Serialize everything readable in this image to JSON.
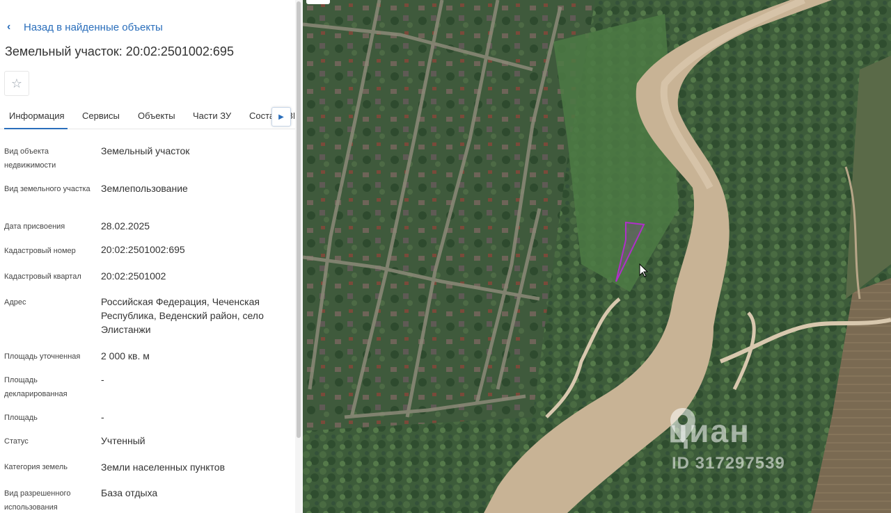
{
  "nav": {
    "back_label": "Назад в найденные объекты"
  },
  "object": {
    "title": "Земельный участок: 20:02:2501002:695"
  },
  "tabs": [
    {
      "label": "Информация"
    },
    {
      "label": "Сервисы"
    },
    {
      "label": "Объекты"
    },
    {
      "label": "Части ЗУ"
    },
    {
      "label": "Состав ЕЗП"
    }
  ],
  "info": [
    {
      "label": "Вид объекта недвижимости",
      "value": "Земельный участок"
    },
    {
      "label": "Вид земельного участка",
      "value": "Землепользование"
    },
    {
      "label": "Дата присвоения",
      "value": "28.02.2025"
    },
    {
      "label": "Кадастровый номер",
      "value": "20:02:2501002:695"
    },
    {
      "label": "Кадастровый квартал",
      "value": "20:02:2501002"
    },
    {
      "label": "Адрес",
      "value": "Российская Федерация, Чеченская Республика, Веденский район, село Элистанжи"
    },
    {
      "label": "Площадь уточненная",
      "value": "2 000 кв. м"
    },
    {
      "label": "Площадь декларированная",
      "value": "-"
    },
    {
      "label": "Площадь",
      "value": "-"
    },
    {
      "label": "Статус",
      "value": "Учтенный"
    },
    {
      "label": "Категория земель",
      "value": "Земли населенных пунктов"
    },
    {
      "label": "Вид разрешенного использования",
      "value": "База отдыха"
    }
  ],
  "watermark": {
    "brand": "циан",
    "id": "ID 317297539"
  },
  "colors": {
    "accent": "#2a6ebb",
    "parcel_outline": "#b02fc9"
  },
  "icons": {
    "back": "chevron-left-icon",
    "favorite": "star-outline-icon",
    "tabs_next": "triangle-right-icon",
    "cursor": "mouse-pointer-icon"
  }
}
